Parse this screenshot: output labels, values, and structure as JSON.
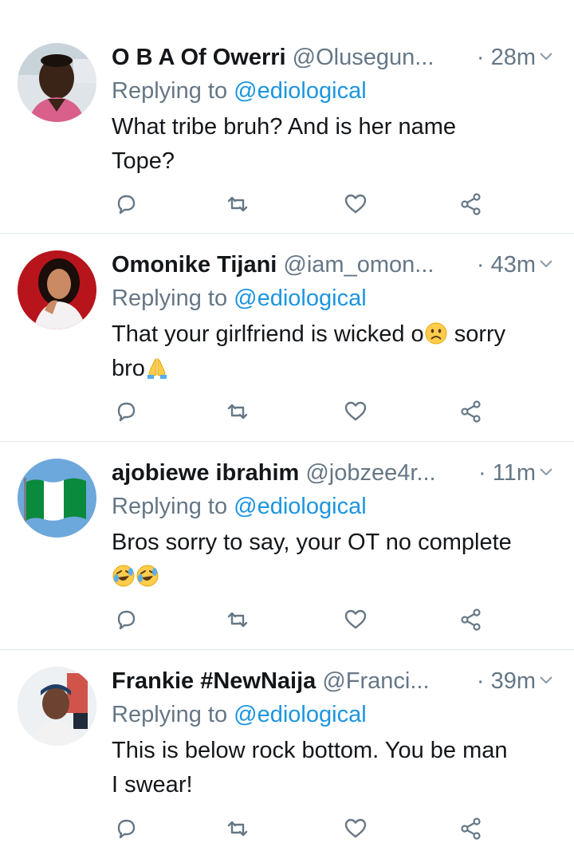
{
  "tweets": [
    {
      "display_name": "O B A Of Owerri",
      "handle": "@Olusegun...",
      "time": "· 28m",
      "replying_prefix": "Replying to ",
      "replying_mention": "@ediological",
      "text_line1": "What tribe bruh? And is her name",
      "text_line2": "Tope?"
    },
    {
      "display_name": "Omonike Tijani",
      "handle": "@iam_omon...",
      "time": "· 43m",
      "replying_prefix": "Replying to ",
      "replying_mention": "@ediological",
      "text_part1": "That your girlfriend is wicked o",
      "text_part2": " sorry",
      "text_line2": "bro"
    },
    {
      "display_name": "ajobiewe ibrahim",
      "handle": "@jobzee4r...",
      "time": "· 11m",
      "replying_prefix": "Replying to ",
      "replying_mention": "@ediological",
      "text_line1": "Bros sorry to say, your OT no complete"
    },
    {
      "display_name": "Frankie #NewNaija",
      "handle": "@Franci...",
      "time": "· 39m",
      "replying_prefix": "Replying to ",
      "replying_mention": "@ediological",
      "text_line1": "This is below rock bottom. You be man",
      "text_line2": "I swear!"
    }
  ],
  "icons": {
    "reply": "reply-icon",
    "retweet": "retweet-icon",
    "like": "heart-icon",
    "share": "share-icon",
    "more": "chevron-down-icon"
  },
  "colors": {
    "text": "#14171a",
    "secondary": "#657786",
    "mention": "#1b95e0",
    "divider": "#e1e8ed"
  }
}
